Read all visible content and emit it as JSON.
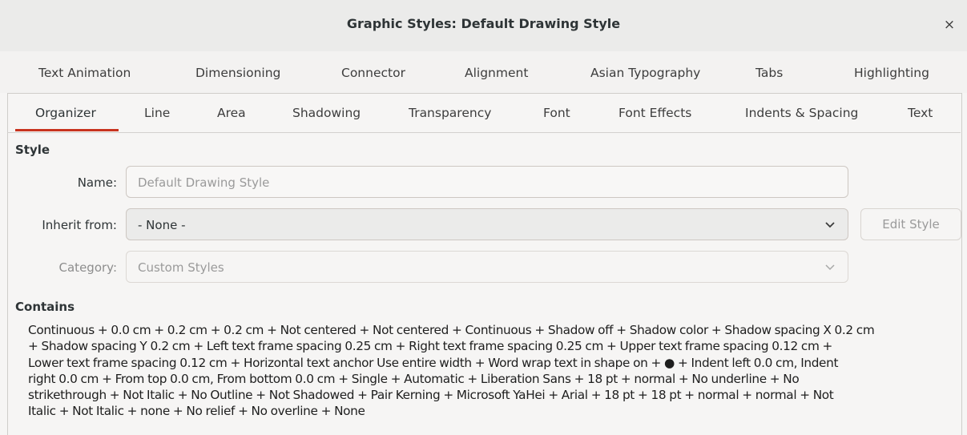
{
  "window": {
    "title": "Graphic Styles: Default Drawing Style",
    "close_glyph": "×"
  },
  "tabs_row1": [
    "Text Animation",
    "Dimensioning",
    "Connector",
    "Alignment",
    "Asian Typography",
    "Tabs",
    "Highlighting"
  ],
  "tabs_row2": [
    "Organizer",
    "Line",
    "Area",
    "Shadowing",
    "Transparency",
    "Font",
    "Font Effects",
    "Indents & Spacing",
    "Text"
  ],
  "active_tab": "Organizer",
  "style_section": {
    "heading": "Style",
    "name_label": "Name:",
    "name_value": "Default Drawing Style",
    "inherit_label": "Inherit from:",
    "inherit_value": "- None -",
    "edit_style_button": "Edit Style",
    "category_label": "Category:",
    "category_value": "Custom Styles"
  },
  "contains_section": {
    "heading": "Contains",
    "lines": [
      "Continuous + 0.0 cm + 0.2 cm + 0.2 cm + Not centered + Not centered + Continuous + Shadow off + Shadow color  + Shadow spacing X 0.2 cm",
      "+ Shadow spacing Y 0.2 cm + Left text frame spacing 0.25 cm + Right text frame spacing 0.25 cm + Upper text frame spacing 0.12 cm +",
      "Lower text frame spacing 0.12 cm + Horizontal text anchor Use entire width + Word wrap text in shape on + ● + Indent left 0.0 cm, Indent",
      "right 0.0 cm + From top 0.0 cm, From bottom 0.0 cm + Single + Automatic + Liberation Sans + 18 pt + normal + No underline + No",
      "strikethrough + Not Italic + No Outline + Not Shadowed + Pair Kerning + Microsoft YaHei + Arial + 18 pt + 18 pt + normal + normal + Not",
      "Italic + Not Italic + none + No relief + No overline + None"
    ]
  },
  "icons": {
    "close": "close-icon",
    "dropdown": "chevron-down-icon"
  },
  "colors": {
    "accent_underline": "#c8341f",
    "window_bg": "#f6f5f4",
    "titlebar_bg": "#ebebea"
  }
}
